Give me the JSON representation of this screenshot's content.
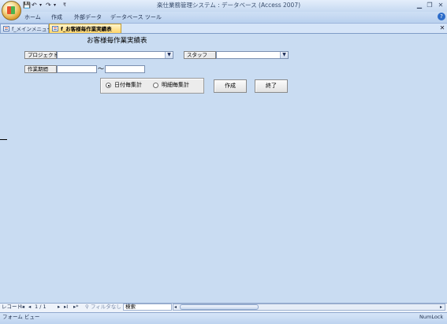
{
  "window": {
    "title": "楽仕業務管理システム : データベース (Access 2007)",
    "controls": [
      "▁",
      "❐",
      "✕"
    ]
  },
  "quick_access": {
    "icons": [
      "save-icon",
      "undo-icon",
      "redo-icon",
      "customize-icon"
    ]
  },
  "ribbon": {
    "tabs": [
      "ホーム",
      "作成",
      "外部データ",
      "データベース ツール"
    ]
  },
  "doc_tabs": [
    {
      "label": "f_メインメニュー",
      "active": false
    },
    {
      "label": "f_お客様毎作業実績表",
      "active": true
    }
  ],
  "form": {
    "title": "お客様毎作業実績表",
    "project_label": "プロジェクト",
    "project_value": "",
    "staff_label": "スタッフ",
    "staff_value": "",
    "period_label": "作業期間",
    "period_from": "",
    "period_separator": "〜",
    "period_to": "",
    "options": [
      {
        "label": "日付毎集計",
        "selected": true
      },
      {
        "label": "明細毎集計",
        "selected": false
      }
    ],
    "create_button": "作成",
    "exit_button": "終了"
  },
  "record_nav": {
    "label": "レコード:",
    "first": "I◂",
    "prev": "◂",
    "position": "1 / 1",
    "next": "▸",
    "last": "▸I",
    "new": "▸*",
    "filter": "フィルタなし",
    "search": "検索"
  },
  "status": {
    "view": "フォーム ビュー",
    "numlock": "NumLock"
  },
  "colors": {
    "accent": "#ffd56a",
    "background": "#c9dcf2"
  }
}
